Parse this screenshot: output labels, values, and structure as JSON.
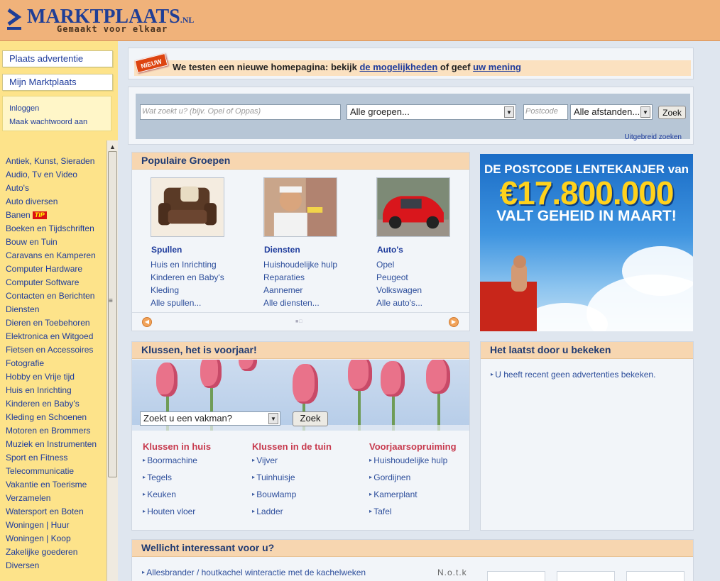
{
  "header": {
    "logo_word": "MARKTPLAATS",
    "logo_suffix": ".NL",
    "tagline": "Gemaakt voor elkaar"
  },
  "sidebar": {
    "place_ad": "Plaats advertentie",
    "my_marktplaats": "Mijn Marktplaats",
    "login": "Inloggen",
    "make_password": "Maak wachtwoord aan",
    "tip_badge": "TIP",
    "categories": [
      "Antiek, Kunst, Sieraden",
      "Audio, Tv en Video",
      "Auto's",
      "Auto diversen",
      "Banen",
      "Boeken en Tijdschriften",
      "Bouw en Tuin",
      "Caravans en Kamperen",
      "Computer Hardware",
      "Computer Software",
      "Contacten en Berichten",
      "Diensten",
      "Dieren en Toebehoren",
      "Elektronica en Witgoed",
      "Fietsen en Accessoires",
      "Fotografie",
      "Hobby en Vrije tijd",
      "Huis en Inrichting",
      "Kinderen en Baby's",
      "Kleding en Schoenen",
      "Motoren en Brommers",
      "Muziek en Instrumenten",
      "Sport en Fitness",
      "Telecommunicatie",
      "Vakantie en Toerisme",
      "Verzamelen",
      "Watersport en Boten",
      "Woningen | Huur",
      "Woningen | Koop",
      "Zakelijke goederen",
      "Diversen"
    ]
  },
  "notice": {
    "badge": "NIEUW",
    "text_before": "We testen een nieuwe homepagina: bekijk ",
    "link1": "de mogelijkheden",
    "text_middle": " of geef ",
    "link2": "uw mening"
  },
  "search": {
    "query_placeholder": "Wat zoekt u? (bijv. Opel of Oppas)",
    "group_selected": "Alle groepen...",
    "postcode_placeholder": "Postcode",
    "distance_selected": "Alle afstanden...",
    "submit": "Zoek",
    "advanced": "Uitgebreid zoeken"
  },
  "popular": {
    "title": "Populaire Groepen",
    "groups": [
      {
        "title": "Spullen",
        "items": [
          "Huis en Inrichting",
          "Kinderen en Baby's",
          "Kleding",
          "Alle spullen..."
        ]
      },
      {
        "title": "Diensten",
        "items": [
          "Huishoudelijke hulp",
          "Reparaties",
          "Aannemer",
          "Alle diensten..."
        ]
      },
      {
        "title": "Auto's",
        "items": [
          "Opel",
          "Peugeot",
          "Volkswagen",
          "Alle auto's..."
        ]
      }
    ]
  },
  "banner": {
    "line1": "DE POSTCODE LENTEKANJER van",
    "line2": "€17.800.000",
    "line3": "VALT GEHEID IN MAART!"
  },
  "klussen": {
    "title": "Klussen, het is voorjaar!",
    "select": "Zoekt u een vakman?",
    "submit": "Zoek",
    "columns": [
      {
        "title": "Klussen in huis",
        "items": [
          "Boormachine",
          "Tegels",
          "Keuken",
          "Houten vloer"
        ]
      },
      {
        "title": "Klussen in de tuin",
        "items": [
          "Vijver",
          "Tuinhuisje",
          "Bouwlamp",
          "Ladder"
        ]
      },
      {
        "title": "Voorjaarsopruiming",
        "items": [
          "Huishoudelijke hulp",
          "Gordijnen",
          "Kamerplant",
          "Tafel"
        ]
      }
    ]
  },
  "recent": {
    "title": "Het laatst door u bekeken",
    "message": "U heeft recent geen advertenties bekeken."
  },
  "interest": {
    "title": "Wellicht interessant voor u?",
    "item": "Allesbrander / houtkachel winteractie met de kachelweken",
    "source": "N.o.t.k"
  },
  "colors": {
    "header_bg": "#f0b27a",
    "sidebar_bg": "#fde38a",
    "link": "#1f3c9c",
    "accent_red": "#c73a4e"
  }
}
